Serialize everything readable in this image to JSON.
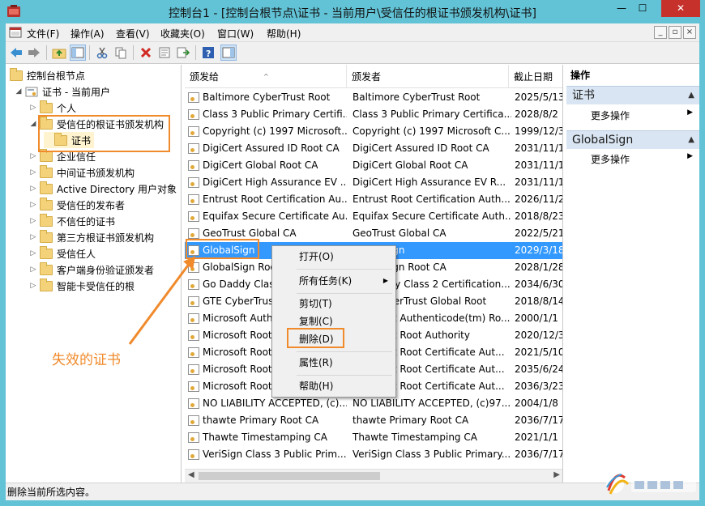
{
  "window": {
    "title": "控制台1 - [控制台根节点\\证书 - 当前用户\\受信任的根证书颁发机构\\证书]",
    "min_glyph": "—",
    "max_glyph": "☐",
    "close_glyph": "✕"
  },
  "menu": {
    "items": [
      "文件(F)",
      "操作(A)",
      "查看(V)",
      "收藏夹(O)",
      "窗口(W)",
      "帮助(H)"
    ],
    "mdi_min": "_",
    "mdi_restore": "▫",
    "mdi_close": "×"
  },
  "tree": {
    "root": "控制台根节点",
    "store": "证书 - 当前用户",
    "nodes": [
      {
        "label": "个人",
        "expander": "▷"
      },
      {
        "label": "受信任的根证书颁发机构",
        "expander": "◢"
      },
      {
        "label": "证书",
        "expander": ""
      },
      {
        "label": "企业信任",
        "expander": "▷"
      },
      {
        "label": "中间证书颁发机构",
        "expander": "▷"
      },
      {
        "label": "Active Directory 用户对象",
        "expander": "▷"
      },
      {
        "label": "受信任的发布者",
        "expander": "▷"
      },
      {
        "label": "不信任的证书",
        "expander": "▷"
      },
      {
        "label": "第三方根证书颁发机构",
        "expander": "▷"
      },
      {
        "label": "受信任人",
        "expander": "▷"
      },
      {
        "label": "客户端身份验证颁发者",
        "expander": "▷"
      },
      {
        "label": "智能卡受信任的根",
        "expander": "▷"
      }
    ]
  },
  "list": {
    "columns": [
      "颁发给",
      "颁发者",
      "截止日期"
    ],
    "sort_glyph": "^",
    "rows": [
      {
        "to": "Baltimore CyberTrust Root",
        "by": "Baltimore CyberTrust Root",
        "exp": "2025/5/13"
      },
      {
        "to": "Class 3 Public Primary Certifi...",
        "by": "Class 3 Public Primary Certifica...",
        "exp": "2028/8/2"
      },
      {
        "to": "Copyright (c) 1997 Microsoft...",
        "by": "Copyright (c) 1997 Microsoft C...",
        "exp": "1999/12/3"
      },
      {
        "to": "DigiCert Assured ID Root CA",
        "by": "DigiCert Assured ID Root CA",
        "exp": "2031/11/1"
      },
      {
        "to": "DigiCert Global Root CA",
        "by": "DigiCert Global Root CA",
        "exp": "2031/11/1"
      },
      {
        "to": "DigiCert High Assurance EV ...",
        "by": "DigiCert High Assurance EV R...",
        "exp": "2031/11/1"
      },
      {
        "to": "Entrust Root Certification Au...",
        "by": "Entrust Root Certification Auth...",
        "exp": "2026/11/2"
      },
      {
        "to": "Equifax Secure Certificate Au...",
        "by": "Equifax Secure Certificate Auth...",
        "exp": "2018/8/23"
      },
      {
        "to": "GeoTrust Global CA",
        "by": "GeoTrust Global CA",
        "exp": "2022/5/21"
      },
      {
        "to": "GlobalSign",
        "by": "GlobalSign",
        "exp": "2029/3/18"
      },
      {
        "to": "GlobalSign Root CA",
        "by": "GlobalSign Root CA",
        "exp": "2028/1/28"
      },
      {
        "to": "Go Daddy Class 2 Certification...",
        "by": "Go Daddy Class 2 Certification...",
        "exp": "2034/6/30"
      },
      {
        "to": "GTE CyberTrust Global Root",
        "by": "GTE CyberTrust Global Root",
        "exp": "2018/8/14"
      },
      {
        "to": "Microsoft Authenticode(tm) Ro...",
        "by": "Microsoft Authenticode(tm) Ro...",
        "exp": "2000/1/1"
      },
      {
        "to": "Microsoft Root Authority",
        "by": "Microsoft Root Authority",
        "exp": "2020/12/3"
      },
      {
        "to": "Microsoft Root Certificate Aut...",
        "by": "Microsoft Root Certificate Aut...",
        "exp": "2021/5/10"
      },
      {
        "to": "Microsoft Root Certificate Aut...",
        "by": "Microsoft Root Certificate Aut...",
        "exp": "2035/6/24"
      },
      {
        "to": "Microsoft Root Certificate Aut...",
        "by": "Microsoft Root Certificate Aut...",
        "exp": "2036/3/23"
      },
      {
        "to": "NO LIABILITY ACCEPTED, (c)...",
        "by": "NO LIABILITY ACCEPTED, (c)97...",
        "exp": "2004/1/8"
      },
      {
        "to": "thawte Primary Root CA",
        "by": "thawte Primary Root CA",
        "exp": "2036/7/17"
      },
      {
        "to": "Thawte Timestamping CA",
        "by": "Thawte Timestamping CA",
        "exp": "2021/1/1"
      },
      {
        "to": "VeriSign Class 3 Public Prim...",
        "by": "VeriSign Class 3 Public Primary...",
        "exp": "2036/7/17"
      }
    ],
    "scroll_left": "◀",
    "scroll_right": "▶"
  },
  "actions": {
    "header": "操作",
    "sections": [
      {
        "title": "证书",
        "item": "更多操作"
      },
      {
        "title": "GlobalSign",
        "item": "更多操作"
      }
    ],
    "collapse_glyph": "▲",
    "more_glyph": "▶"
  },
  "context_menu": {
    "items": [
      "打开(O)",
      "所有任务(K)",
      "剪切(T)",
      "复制(C)",
      "删除(D)",
      "属性(R)",
      "帮助(H)"
    ],
    "submenu_glyph": "▶"
  },
  "annotation": {
    "label": "失效的证书",
    "color": "#f08a2b"
  },
  "status": {
    "text": "删除当前所选内容。"
  },
  "colors": {
    "title_bg": "#62c3d6",
    "selection": "#3399ff",
    "action_section": "#d9e5f2",
    "close_btn": "#c7312b"
  }
}
